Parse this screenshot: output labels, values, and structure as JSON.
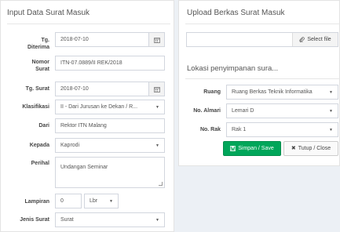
{
  "left_panel": {
    "title": "Input Data Surat Masuk",
    "fields": {
      "tgl_diterima": {
        "label_line1": "Tg.",
        "label_line2": "Diterima",
        "value": "2018-07-10"
      },
      "nomor_surat": {
        "label_line1": "Nomor",
        "label_line2": "Surat",
        "value": "ITN-07.0889/II REK/2018"
      },
      "tgl_surat": {
        "label": "Tg. Surat",
        "value": "2018-07-10"
      },
      "klasifikasi": {
        "label": "Klasifikasi",
        "value": "II - Dari Jurusan ke Dekan / R..."
      },
      "dari": {
        "label": "Dari",
        "value": "Rektor ITN Malang"
      },
      "kepada": {
        "label": "Kepada",
        "value": "Kaprodi"
      },
      "perihal": {
        "label": "Perihal",
        "value": "Undangan Seminar"
      },
      "lampiran": {
        "label": "Lampiran",
        "value": "0",
        "unit": "Lbr"
      },
      "jenis_surat": {
        "label": "Jenis Surat",
        "value": "Surat"
      }
    }
  },
  "right_panel": {
    "title": "Upload Berkas Surat Masuk",
    "file_input_value": "",
    "select_file_label": "Select file",
    "storage_title": "Lokasi penyimpanan sura...",
    "fields": {
      "ruang": {
        "label": "Ruang",
        "value": "Ruang Berkas Teknik Informatika"
      },
      "no_almari": {
        "label": "No. Almari",
        "value": "Lemari D"
      },
      "no_rak": {
        "label": "No. Rak",
        "value": "Rak 1"
      }
    },
    "save_label": "Simpan / Save",
    "close_label": "Tutup / Close"
  },
  "icons": {
    "calendar": "calendar-icon",
    "paperclip": "paperclip-icon",
    "save": "save-icon",
    "close": "close-icon",
    "caret": "caret-down-icon"
  },
  "colors": {
    "save_button": "#00a65a",
    "background": "#ecf0f5"
  }
}
